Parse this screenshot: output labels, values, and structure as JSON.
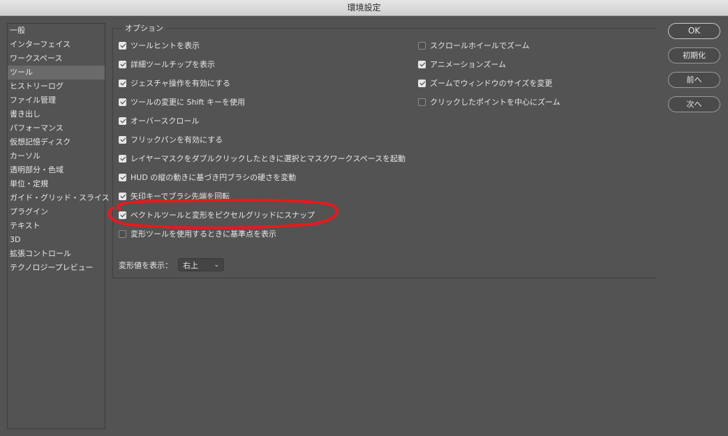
{
  "window": {
    "title": "環境設定"
  },
  "sidebar": {
    "items": [
      {
        "label": "一般"
      },
      {
        "label": "インターフェイス"
      },
      {
        "label": "ワークスペース"
      },
      {
        "label": "ツール",
        "selected": true
      },
      {
        "label": "ヒストリーログ"
      },
      {
        "label": "ファイル管理"
      },
      {
        "label": "書き出し"
      },
      {
        "label": "パフォーマンス"
      },
      {
        "label": "仮想記憶ディスク"
      },
      {
        "label": "カーソル"
      },
      {
        "label": "透明部分・色域"
      },
      {
        "label": "単位・定規"
      },
      {
        "label": "ガイド・グリッド・スライス"
      },
      {
        "label": "プラグイン"
      },
      {
        "label": "テキスト"
      },
      {
        "label": "3D"
      },
      {
        "label": "拡張コントロール"
      },
      {
        "label": "テクノロジープレビュー"
      }
    ]
  },
  "options": {
    "group_label": "オプション",
    "left": [
      {
        "label": "ツールヒントを表示",
        "checked": true
      },
      {
        "label": "詳細ツールチップを表示",
        "checked": true
      },
      {
        "label": "ジェスチャ操作を有効にする",
        "checked": true
      },
      {
        "label": "ツールの変更に Shift キーを使用",
        "checked": true
      },
      {
        "label": "オーバースクロール",
        "checked": true
      },
      {
        "label": "フリックパンを有効にする",
        "checked": true
      },
      {
        "label": "レイヤーマスクをダブルクリックしたときに選択とマスクワークスペースを起動",
        "checked": true
      },
      {
        "label": "HUD の縦の動きに基づき円ブラシの硬さを変動",
        "checked": true
      },
      {
        "label": "矢印キーでブラシ先端を回転",
        "checked": true
      },
      {
        "label": "ベクトルツールと変形をピクセルグリッドにスナップ",
        "checked": true
      },
      {
        "label": "変形ツールを使用するときに基準点を表示",
        "checked": false
      }
    ],
    "right": [
      {
        "label": "スクロールホイールでズーム",
        "checked": false
      },
      {
        "label": "アニメーションズーム",
        "checked": true
      },
      {
        "label": "ズームでウィンドウのサイズを変更",
        "checked": true
      },
      {
        "label": "クリックしたポイントを中心にズーム",
        "checked": false
      }
    ],
    "transform_display": {
      "label": "変形値を表示：",
      "value": "右上"
    }
  },
  "buttons": {
    "ok": "OK",
    "reset": "初期化",
    "prev": "前へ",
    "next": "次へ"
  },
  "colors": {
    "annotation": "#e8191e",
    "background": "#535353"
  }
}
